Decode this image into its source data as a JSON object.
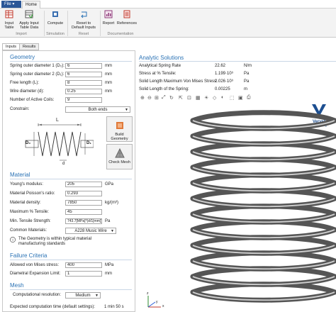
{
  "menu": {
    "file": "File ▾",
    "home": "Home"
  },
  "ribbon": {
    "input_table": "Input\nTable",
    "apply_input": "Apply Input\nTable Data",
    "compute": "Compute",
    "reset": "Reset to\nDefault Inputs",
    "report": "Report",
    "references": "References",
    "groups": {
      "import": "Import",
      "simulation": "Simulation",
      "reset": "Reset",
      "documentation": "Documentation"
    }
  },
  "tabs": [
    "Inputs",
    "Results"
  ],
  "geometry": {
    "title": "Geometry",
    "fields": [
      {
        "label": "Spring outer diameter 1 (D₀):",
        "value": "6",
        "unit": "mm"
      },
      {
        "label": "Spring outer diameter 2 (D₁):",
        "value": "6",
        "unit": "mm"
      },
      {
        "label": "Free length (L):",
        "value": "8",
        "unit": "mm"
      },
      {
        "label": "Wire diameter (d):",
        "value": "0.25",
        "unit": "mm"
      },
      {
        "label": "Number of Active Coils:",
        "value": "9",
        "unit": ""
      }
    ],
    "constrain_label": "Constrain:",
    "constrain_value": "Both ends",
    "build_label": "Build Geometry",
    "check_mesh": "Check Mesh",
    "diagram": {
      "L": "L",
      "D0": "D₀",
      "D1": "D₁",
      "d": "d"
    }
  },
  "material": {
    "title": "Material",
    "fields": [
      {
        "label": "Young's modulus:",
        "value": "205",
        "unit": "GPa"
      },
      {
        "label": "Material Poisson's ratio:",
        "value": "0.293",
        "unit": ""
      },
      {
        "label": "Material density:",
        "value": "7850",
        "unit": "kg/(m³)"
      },
      {
        "label": "Maximum % Tensile:",
        "value": "45",
        "unit": ""
      },
      {
        "label": "Min. Tensile Strength:",
        "value": "743.7[MPa]*(d/1[mm])^(-0",
        "unit": "Pa"
      }
    ],
    "common_label": "Common Materials:",
    "common_value": "A228 Music Wire",
    "note": "The Geometry is within typical material manufacturing standards"
  },
  "failure": {
    "title": "Failure Criteria",
    "fields": [
      {
        "label": "Allowed von Mises stress:",
        "value": "400",
        "unit": "MPa"
      },
      {
        "label": "Diametral Expansion Limit:",
        "value": "1",
        "unit": "mm"
      }
    ]
  },
  "mesh": {
    "title": "Mesh",
    "resolution_label": "Computational resolution:",
    "resolution_value": "Medium",
    "time_label": "Expected computation time (default settings):",
    "time_value": "1 min 50 s"
  },
  "analytic": {
    "title": "Analytic Solutions",
    "rows": [
      {
        "label": "Analytical Spring Rate",
        "value": "22.62",
        "unit": "N/m"
      },
      {
        "label": "Stress at % Tensile:",
        "value": "1.199·10⁹",
        "unit": "Pa"
      },
      {
        "label": "Solid Length Maximum Von Mises Stress:",
        "value": "2.026·10⁹",
        "unit": "Pa"
      },
      {
        "label": "Solid Length of the Spring:",
        "value": "0.00225",
        "unit": "m"
      }
    ]
  },
  "logo": {
    "name": "Veryst",
    "sub": "Engineering"
  },
  "axes": {
    "x": "x",
    "y": "y",
    "z": "z"
  },
  "colors": {
    "accent": "#2a72b5",
    "file_bg": "#2b5797"
  }
}
